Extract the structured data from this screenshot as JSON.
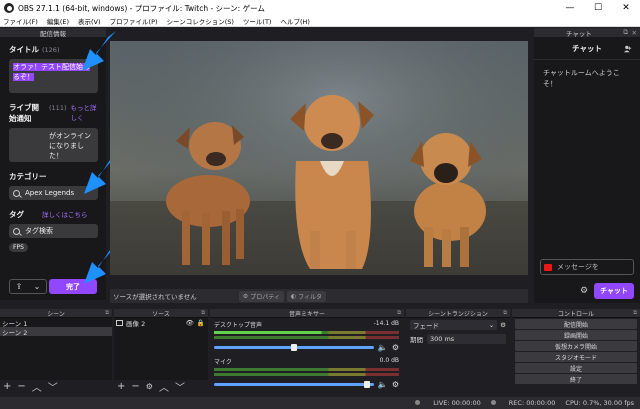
{
  "window": {
    "title": "OBS 27.1.1 (64-bit, windows) - プロファイル: Twitch - シーン: ゲーム",
    "minimize": "—",
    "maximize": "☐",
    "close": "✕"
  },
  "menu": [
    "ファイル(F)",
    "編集(E)",
    "表示(V)",
    "プロファイル(P)",
    "シーンコレクション(S)",
    "ツール(T)",
    "ヘルプ(H)"
  ],
  "info_panel": {
    "header": "配信情報",
    "title_label": "タイトル",
    "title_count": "(126)",
    "title_value": "オラァ！テスト配信始めるぞ！",
    "notify_label": "ライブ開始通知",
    "notify_count": "(111)",
    "notify_more": "もっと詳しく",
    "notify_value": "がオンラインになりました！",
    "category_label": "カテゴリー",
    "category_value": "Apex Legends",
    "tags_label": "タグ",
    "tags_more": "詳しくはこちら",
    "tags_placeholder": "タグ検索",
    "tag_chip": "FPS",
    "done_button": "完了"
  },
  "source_bar": {
    "status": "ソースが選択されていません",
    "properties": "プロパティ",
    "filters": "フィルタ"
  },
  "chat": {
    "dock_title": "チャット",
    "header": "チャット",
    "welcome": "チャットルームへようこそ！",
    "message_placeholder": "メッセージを",
    "send_button": "チャット"
  },
  "scenes": {
    "header": "シーン",
    "items": [
      "シーン 1",
      "シーン 2"
    ]
  },
  "sources": {
    "header": "ソース",
    "items": [
      "画像 2"
    ]
  },
  "mixer": {
    "header": "音声ミキサー",
    "tracks": [
      {
        "name": "デスクトップ音声",
        "db": "-14.1 dB",
        "volume": 0.85
      },
      {
        "name": "マイク",
        "db": "0.0 dB",
        "volume": 1.0
      }
    ]
  },
  "transitions": {
    "header": "シーントランジション",
    "type": "フェード",
    "duration_label": "期間",
    "duration_value": "300 ms"
  },
  "controls": {
    "header": "コントロール",
    "buttons": [
      "配信開始",
      "録画開始",
      "仮想カメラ開始",
      "スタジオモード",
      "設定",
      "終了"
    ]
  },
  "status": {
    "live": "LIVE: 00:00:00",
    "rec": "REC: 00:00:00",
    "cpu": "CPU: 0.7%, 30.00 fps"
  },
  "colors": {
    "accent": "#9147ff",
    "arrow": "#1e90ff",
    "bg": "#1f1f23"
  }
}
